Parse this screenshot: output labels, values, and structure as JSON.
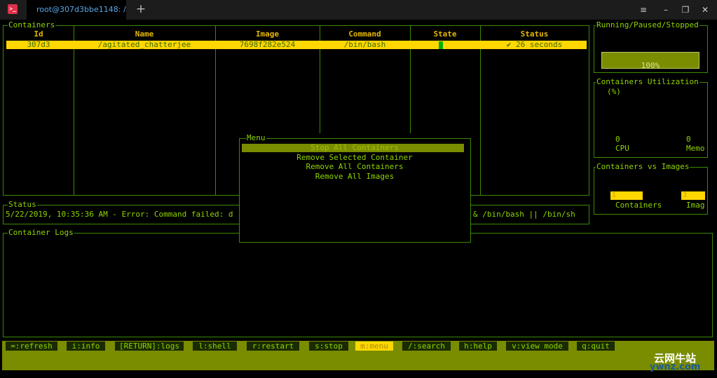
{
  "window": {
    "tab_title": "root@307d3bbe1148: /",
    "app_icon": "terminal-icon",
    "new_tab_symbol": "+",
    "buttons": {
      "menu": "≡",
      "minimize": "–",
      "maximize": "❐",
      "close": "✕"
    }
  },
  "containers": {
    "title": "Containers",
    "headers": [
      "Id",
      "Name",
      "Image",
      "Command",
      "State",
      "Status"
    ],
    "rows": [
      {
        "id": "307d3",
        "name": "/agitated_chatterjee",
        "image": "7698f282e524",
        "command": "/bin/bash",
        "state": "running",
        "status": "✔ 26 seconds"
      }
    ]
  },
  "status_panel": {
    "title": "Status",
    "left_text": "5/22/2019, 10:35:36 AM - Error: Command failed: d",
    "right_text": "& /bin/bash || /bin/sh"
  },
  "logs_panel": {
    "title": "Container Logs"
  },
  "running_panel": {
    "title": "Running/Paused/Stopped",
    "percent": 100,
    "label": "100%"
  },
  "utilization_panel": {
    "title": "Containers Utilization",
    "subtitle": "(%)",
    "cpu_value": "0",
    "cpu_label": "CPU",
    "memo_value": "0",
    "memo_label": "Memo"
  },
  "cvi_panel": {
    "title": "Containers vs Images",
    "containers_value": "1",
    "containers_label": "Containers",
    "images_value": "3",
    "images_label": "Imag"
  },
  "menu": {
    "title": "Menu",
    "items": [
      "Stop All Containers",
      "Remove Selected Container",
      "Remove All Containers",
      "Remove All Images"
    ],
    "selected_index": 0
  },
  "footer": {
    "keys": [
      "=:refresh",
      "i:info",
      "[RETURN]:logs",
      "l:shell",
      "r:restart",
      "s:stop",
      "m:menu",
      "/:search",
      "h:help",
      "v:view mode",
      "q:quit"
    ],
    "active_index": 6
  },
  "watermark": {
    "cn": "云网牛站",
    "url": "ywnz.com"
  },
  "colors": {
    "accent": "#8fd400",
    "border": "#3a8a00",
    "highlight": "#ffd700",
    "olive": "#7a8c00",
    "header": "#e5b800"
  }
}
